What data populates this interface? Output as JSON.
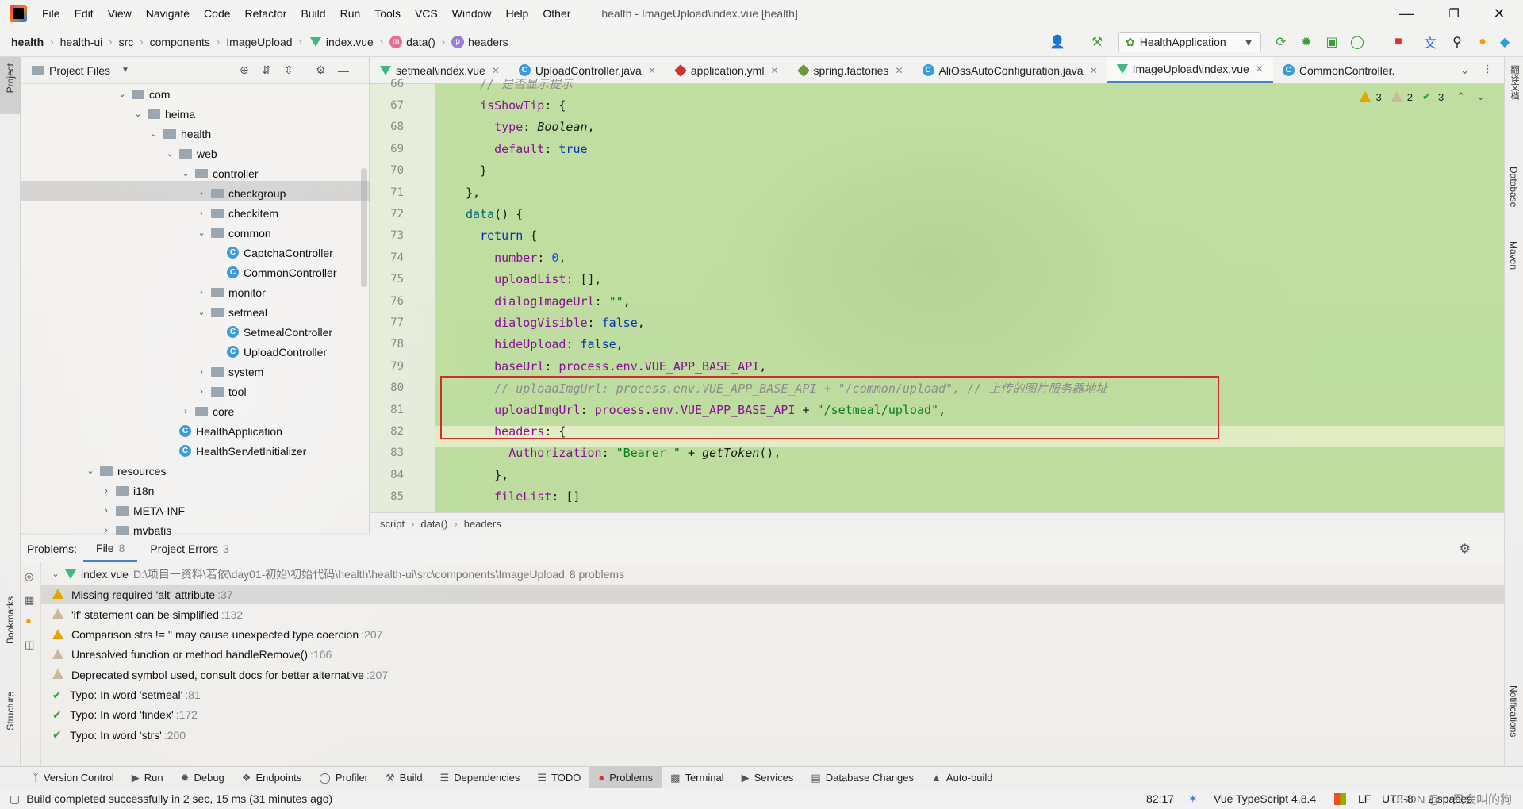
{
  "menu": {
    "items": [
      "File",
      "Edit",
      "View",
      "Navigate",
      "Code",
      "Refactor",
      "Build",
      "Run",
      "Tools",
      "VCS",
      "Window",
      "Help",
      "Other"
    ],
    "window_title": "health - ImageUpload\\index.vue [health]"
  },
  "nav": {
    "crumbs": [
      "health",
      "health-ui",
      "src",
      "components",
      "ImageUpload",
      "index.vue",
      "data()",
      "headers"
    ],
    "run_config": "HealthApplication"
  },
  "left_stripe": {
    "project": "Project",
    "bookmarks": "Bookmarks",
    "structure": "Structure"
  },
  "right_stripe": {
    "database": "Database",
    "maven": "Maven",
    "notifications": "Notifications",
    "top": "翻译文档"
  },
  "project": {
    "header": "Project Files",
    "tree": [
      {
        "label": "com",
        "type": "folder",
        "open": true
      },
      {
        "label": "heima",
        "type": "folder",
        "open": true
      },
      {
        "label": "health",
        "type": "folder",
        "open": true
      },
      {
        "label": "web",
        "type": "folder",
        "open": true
      },
      {
        "label": "controller",
        "type": "folder",
        "open": true
      },
      {
        "label": "checkgroup",
        "type": "folder",
        "open": false
      },
      {
        "label": "checkitem",
        "type": "folder",
        "open": false
      },
      {
        "label": "common",
        "type": "folder",
        "open": true
      },
      {
        "label": "CaptchaController",
        "type": "class"
      },
      {
        "label": "CommonController",
        "type": "class"
      },
      {
        "label": "monitor",
        "type": "folder",
        "open": false
      },
      {
        "label": "setmeal",
        "type": "folder",
        "open": true
      },
      {
        "label": "SetmealController",
        "type": "class"
      },
      {
        "label": "UploadController",
        "type": "class"
      },
      {
        "label": "system",
        "type": "folder",
        "open": false
      },
      {
        "label": "tool",
        "type": "folder",
        "open": false
      },
      {
        "label": "core",
        "type": "folder",
        "open": false
      },
      {
        "label": "HealthApplication",
        "type": "class"
      },
      {
        "label": "HealthServletInitializer",
        "type": "class"
      },
      {
        "label": "resources",
        "type": "folder",
        "open": true
      },
      {
        "label": "i18n",
        "type": "folder",
        "open": false
      },
      {
        "label": "META-INF",
        "type": "folder",
        "open": false
      },
      {
        "label": "mybatis",
        "type": "folder",
        "open": false
      }
    ]
  },
  "editor": {
    "tabs": [
      {
        "label": "setmeal\\index.vue",
        "icon": "vue-icon"
      },
      {
        "label": "UploadController.java",
        "icon": "class-icon"
      },
      {
        "label": "application.yml",
        "icon": "yml-icon"
      },
      {
        "label": "spring.factories",
        "icon": "config-icon"
      },
      {
        "label": "AliOssAutoConfiguration.java",
        "icon": "class-icon"
      },
      {
        "label": "ImageUpload\\index.vue",
        "icon": "vue-icon"
      },
      {
        "label": "CommonController.",
        "icon": "class-icon"
      }
    ],
    "inspections": {
      "warnings": "3",
      "weak_warnings": "2",
      "typos": "3"
    },
    "line_numbers": [
      "66",
      "67",
      "68",
      "69",
      "70",
      "71",
      "72",
      "73",
      "74",
      "75",
      "76",
      "77",
      "78",
      "79",
      "80",
      "81",
      "82",
      "83",
      "84",
      "85"
    ],
    "breadcrumb": [
      "script",
      "data()",
      "headers"
    ]
  },
  "problems": {
    "label": "Problems:",
    "tabs": [
      {
        "label": "File",
        "count": "8"
      },
      {
        "label": "Project Errors",
        "count": "3"
      }
    ],
    "file": {
      "name": "index.vue",
      "path": "D:\\项目一资料\\若依\\day01-初始\\初始代码\\health\\health-ui\\src\\components\\ImageUpload",
      "count": "8 problems"
    },
    "rows": [
      {
        "text": "Missing required 'alt' attribute",
        "line": ":37",
        "kind": "warning"
      },
      {
        "text": "'if' statement can be simplified",
        "line": ":132",
        "kind": "weak"
      },
      {
        "text": "Comparison strs != '' may cause unexpected type coercion",
        "line": ":207",
        "kind": "warning"
      },
      {
        "text": "Unresolved function or method handleRemove()",
        "line": ":166",
        "kind": "weak"
      },
      {
        "text": "Deprecated symbol used, consult docs for better alternative",
        "line": ":207",
        "kind": "weak"
      },
      {
        "text": "Typo: In word 'setmeal'",
        "line": ":81",
        "kind": "typo"
      },
      {
        "text": "Typo: In word 'findex'",
        "line": ":172",
        "kind": "typo"
      },
      {
        "text": "Typo: In word 'strs'",
        "line": ":200",
        "kind": "typo"
      }
    ]
  },
  "tool_windows": [
    "Version Control",
    "Run",
    "Debug",
    "Endpoints",
    "Profiler",
    "Build",
    "Dependencies",
    "TODO",
    "Problems",
    "Terminal",
    "Services",
    "Database Changes",
    "Auto-build"
  ],
  "status": {
    "message": "Build completed successfully in 2 sec, 15 ms (31 minutes ago)",
    "position": "82:17",
    "language": "Vue TypeScript 4.8.4",
    "line_sep": "LF",
    "encoding": "UTF-8",
    "indent": "2 spaces",
    "watermark": "CSDN @一只会叫的狗"
  }
}
